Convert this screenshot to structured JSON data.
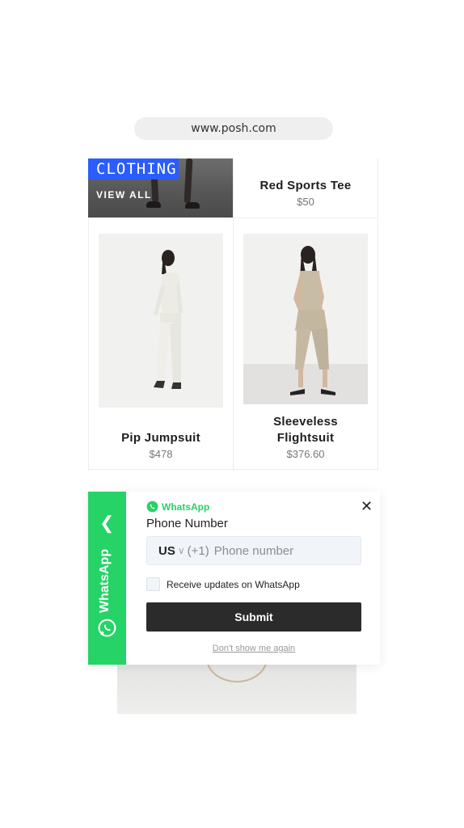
{
  "browser": {
    "url": "www.posh.com"
  },
  "promo": {
    "tag": "CLOTHING",
    "cta": "VIEW ALL"
  },
  "products": [
    {
      "title": "Red Sports Tee",
      "price": "$50"
    },
    {
      "title": "Pip Jumpsuit",
      "price": "$478"
    },
    {
      "title": "Sleeveless Flightsuit",
      "price": "$376.60"
    }
  ],
  "popup": {
    "side_label": "WhatsApp",
    "brand": "WhatsApp",
    "title": "Phone Number",
    "country_code": "US",
    "dial_prefix": "(+1)",
    "phone_placeholder": "Phone number",
    "checkbox_label": "Receive updates on WhatsApp",
    "checkbox_checked": false,
    "submit_label": "Submit",
    "dismiss_label": "Don't show me again",
    "brand_color": "#25d366"
  },
  "icons": {
    "side_toggle": "chevron-left-icon",
    "close": "close-icon",
    "brand": "whatsapp-icon"
  }
}
